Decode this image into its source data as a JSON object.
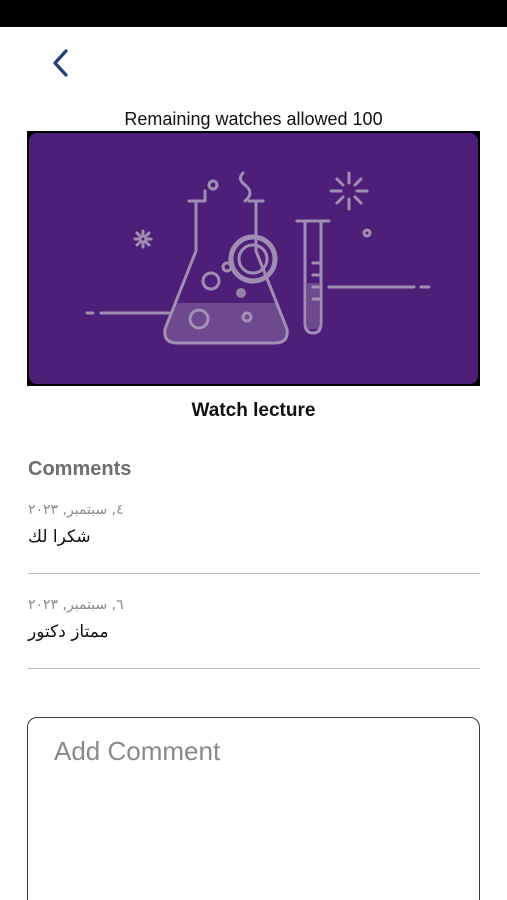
{
  "header": {
    "back_icon": "chevron-left-icon",
    "accent_color": "#1c3f78"
  },
  "video": {
    "remaining_text": "Remaining watches allowed 100",
    "thumbnail_icon": "chemistry-lab-flask-icon",
    "background_color": "#4e1f78",
    "watch_label": "Watch lecture"
  },
  "comments": {
    "heading": "Comments",
    "items": [
      {
        "date": "٤, سبتمبر, ٢٠٢٣",
        "text": "شكرا لك"
      },
      {
        "date": "٦, سبتمبر, ٢٠٢٣",
        "text": "ممتاز دكتور"
      }
    ]
  },
  "add_comment": {
    "placeholder": "Add Comment"
  }
}
